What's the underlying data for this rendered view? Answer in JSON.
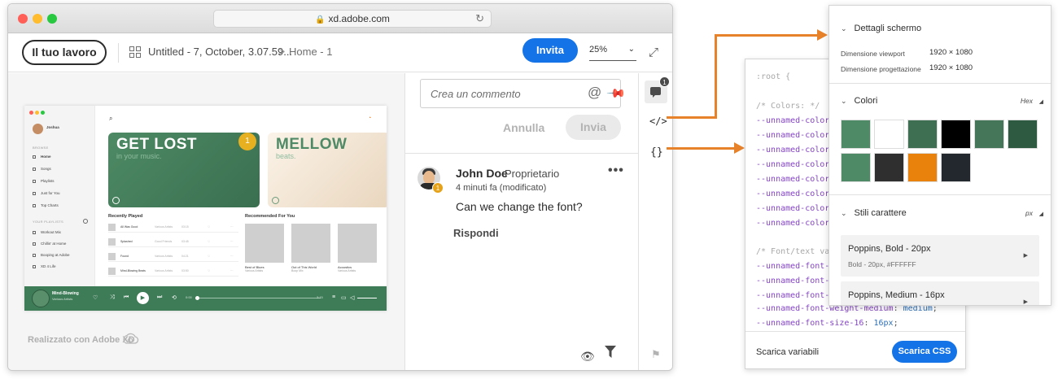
{
  "browser": {
    "url": "xd.adobe.com",
    "traffic_lights": [
      "#ff5f57",
      "#febc2e",
      "#28c840"
    ]
  },
  "toolbar": {
    "your_work_label": "Il tuo lavoro",
    "document_name": "Untitled - 7, October, 3.07.59...",
    "breadcrumb_separator": ">",
    "page_name": "Home - 1",
    "invite_label": "Invita",
    "zoom_value": "25%",
    "accent_color": "#1473e6"
  },
  "artboard": {
    "user_name": "Joshua",
    "browse_heading": "BROWSE",
    "nav_items": [
      "Home",
      "Songs",
      "Playlists",
      "Just for You",
      "Top Charts"
    ],
    "playlists_heading": "YOUR PLAYLISTS",
    "playlists": [
      "Workout Mix",
      "Chillin' at Home",
      "Booping at Adobe",
      "XD 4 Life"
    ],
    "card1_title": "GET LOST",
    "card1_sub": "in your music.",
    "card2_title": "MELLOW",
    "card2_sub": "beats.",
    "pin_number": "1",
    "recent_title": "Recently Played",
    "recent_rows": [
      {
        "name": "All Was Good",
        "artist": "Various Artists",
        "time": "03:15"
      },
      {
        "name": "Splashed",
        "artist": "Good Friends",
        "time": "03:45"
      },
      {
        "name": "Found",
        "artist": "Various Artists",
        "time": "04:21"
      },
      {
        "name": "Mind-Blowing Beats",
        "artist": "Various Artists",
        "time": "03:50"
      }
    ],
    "rec_title": "Recommended For You",
    "rec_tiles": [
      {
        "name": "Best of Blues",
        "sub": "Various Artists"
      },
      {
        "name": "Out of This World",
        "sub": "Boop Mix"
      },
      {
        "name": "Acoustics",
        "sub": "Various Artists"
      }
    ],
    "player_title": "Mind-Blowing",
    "player_artist": "Various Artists",
    "player_time_start": "0:00",
    "player_time_end": "3:15",
    "player_color": "#3e7b57"
  },
  "stage": {
    "made_with": "Realizzato con Adobe XD"
  },
  "comments": {
    "input_placeholder": "Crea un commento",
    "cancel_label": "Annulla",
    "send_label": "Invia",
    "author": "John Doe",
    "role": "Proprietario",
    "time": "4 minuti fa (modificato)",
    "text": "Can we change the font?",
    "reply_label": "Rispondi",
    "avatar_badge": "1",
    "more_label": "•••"
  },
  "rail": {
    "comment_count": "1",
    "code_icon": "</>",
    "braces_icon": "{}"
  },
  "css_panel": {
    "lines": [
      {
        "text": ":root {",
        "cls": "c-comment"
      },
      {
        "text": "/* Colors: */",
        "cls": "c-comment"
      },
      {
        "text": "--unnamed-color-",
        "cls": "c-var"
      },
      {
        "text": "--unnamed-color-",
        "cls": "c-var"
      },
      {
        "text": "--unnamed-color-",
        "cls": "c-var"
      },
      {
        "text": "--unnamed-color-",
        "cls": "c-var"
      },
      {
        "text": "--unnamed-color-",
        "cls": "c-var"
      },
      {
        "text": "--unnamed-color-",
        "cls": "c-var"
      },
      {
        "text": "--unnamed-color-",
        "cls": "c-var"
      },
      {
        "text": "--unnamed-color-",
        "cls": "c-var"
      },
      {
        "text": "/* Font/text val",
        "cls": "c-comment"
      },
      {
        "text": "--unnamed-font-f",
        "cls": "c-var"
      },
      {
        "text": "--unnamed-font-s",
        "cls": "c-var"
      },
      {
        "text": "--unnamed-font-w",
        "cls": "c-var"
      },
      {
        "text": "--unnamed-font-weight-medium: medium;",
        "cls": "c-mixed",
        "prop": "--unnamed-font-weight-medium",
        "val": "medium"
      },
      {
        "text": "--unnamed-font-size-16: 16px;",
        "cls": "c-mixed2",
        "prop": "--unnamed-font-size-16",
        "val": "16px"
      }
    ],
    "download_vars": "Scarica variabili",
    "download_css": "Scarica CSS"
  },
  "inspect": {
    "screen_details_title": "Dettagli schermo",
    "viewport_label": "Dimensione viewport",
    "viewport_value": "1920 × 1080",
    "design_label": "Dimensione progettazione",
    "design_value": "1920 × 1080",
    "colors_title": "Colori",
    "colors_format": "Hex",
    "swatches": [
      "#4f8a66",
      "#ffffff",
      "#3e6f53",
      "#000000",
      "#46765a",
      "#2f5a42",
      "#4f8a66",
      "#2f2f2f",
      "#e8820c",
      "#23282e"
    ],
    "char_styles_title": "Stili carattere",
    "char_styles_unit": "px",
    "styles": [
      {
        "name": "Poppins, Bold - 20px",
        "sub": "Bold - 20px, #FFFFFF"
      },
      {
        "name": "Poppins, Medium - 16px",
        "sub": ""
      }
    ]
  }
}
